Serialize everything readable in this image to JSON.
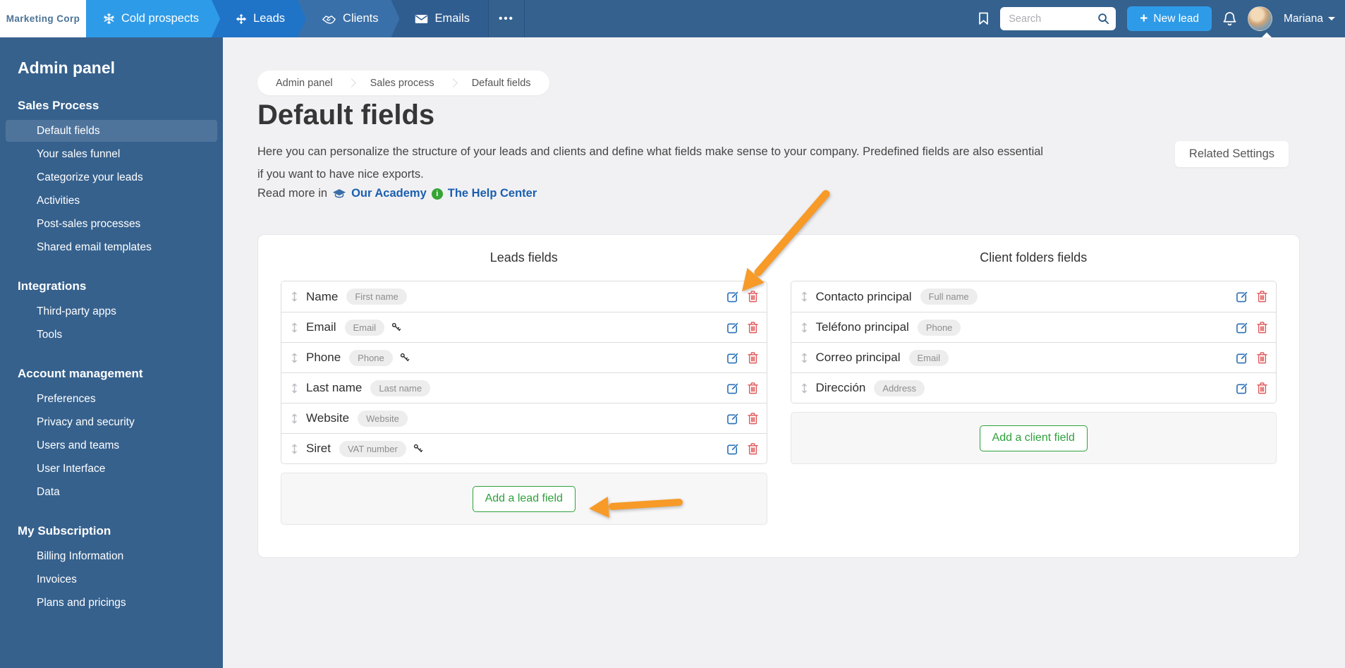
{
  "topbar": {
    "logo": "Marketing Corp",
    "tabs": [
      {
        "label": "Cold prospects",
        "icon": "snowflake-icon"
      },
      {
        "label": "Leads",
        "icon": "arrows-icon"
      },
      {
        "label": "Clients",
        "icon": "handshake-icon"
      },
      {
        "label": "Emails",
        "icon": "envelope-icon"
      }
    ],
    "search_placeholder": "Search",
    "new_lead_label": "New lead",
    "user_name": "Mariana"
  },
  "sidebar": {
    "title": "Admin panel",
    "active_item": "Default fields",
    "sections": [
      {
        "heading": "Sales Process",
        "items": [
          "Default fields",
          "Your sales funnel",
          "Categorize your leads",
          "Activities",
          "Post-sales processes",
          "Shared email templates"
        ]
      },
      {
        "heading": "Integrations",
        "items": [
          "Third-party apps",
          "Tools"
        ]
      },
      {
        "heading": "Account management",
        "items": [
          "Preferences",
          "Privacy and security",
          "Users and teams",
          "User Interface",
          "Data"
        ]
      },
      {
        "heading": "My Subscription",
        "items": [
          "Billing Information",
          "Invoices",
          "Plans and pricings"
        ]
      }
    ]
  },
  "breadcrumb": [
    "Admin panel",
    "Sales process",
    "Default fields"
  ],
  "page": {
    "title": "Default fields",
    "description_line1": "Here you can personalize the structure of your leads and clients and define what fields make sense to your company. Predefined fields are also essential",
    "description_line2": "if you want to have nice exports.",
    "read_more_prefix": "Read more in",
    "academy_link": "Our Academy",
    "help_link": "The Help Center",
    "related_settings_label": "Related Settings"
  },
  "leads_fields": {
    "title": "Leads fields",
    "rows": [
      {
        "name": "Name",
        "tag": "First name",
        "key": false
      },
      {
        "name": "Email",
        "tag": "Email",
        "key": true
      },
      {
        "name": "Phone",
        "tag": "Phone",
        "key": true
      },
      {
        "name": "Last name",
        "tag": "Last name",
        "key": false
      },
      {
        "name": "Website",
        "tag": "Website",
        "key": false
      },
      {
        "name": "Siret",
        "tag": "VAT number",
        "key": true
      }
    ],
    "add_button": "Add a lead field"
  },
  "client_fields": {
    "title": "Client folders fields",
    "rows": [
      {
        "name": "Contacto principal",
        "tag": "Full name",
        "key": false
      },
      {
        "name": "Teléfono principal",
        "tag": "Phone",
        "key": false
      },
      {
        "name": "Correo principal",
        "tag": "Email",
        "key": false
      },
      {
        "name": "Dirección",
        "tag": "Address",
        "key": false
      }
    ],
    "add_button": "Add a client field"
  },
  "colors": {
    "topbar": "#35618E",
    "tab_active": "#2E9BE8",
    "tab_leads": "#1F74C8",
    "tab_clients": "#3A70A9",
    "sidebar": "#36618D",
    "sidebar_active": "#4F749C",
    "link_blue": "#1B5FAF",
    "button_green": "#2EA13B",
    "annotation_orange": "#F79A28",
    "edit_blue": "#2A6FB5",
    "delete_red": "#E05A5C",
    "page_bg": "#F1F1F3"
  }
}
